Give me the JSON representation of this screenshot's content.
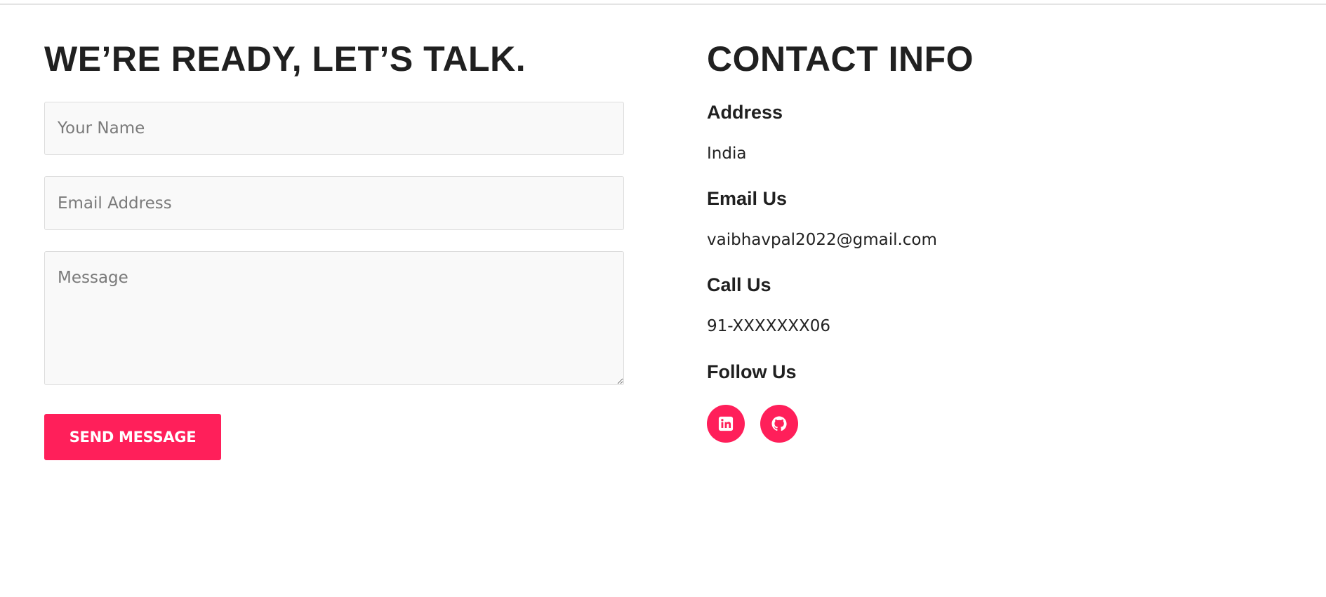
{
  "form": {
    "heading": "WE’RE READY, LET’S TALK.",
    "name_placeholder": "Your Name",
    "email_placeholder": "Email Address",
    "message_placeholder": "Message",
    "send_label": "SEND MESSAGE"
  },
  "contact": {
    "title": "CONTACT INFO",
    "address_label": "Address",
    "address_value": "India",
    "email_label": "Email Us",
    "email_value": "vaibhavpal2022@gmail.com",
    "call_label": "Call Us",
    "call_value": "91-XXXXXXX06",
    "follow_label": "Follow Us",
    "socials": [
      {
        "icon": "linkedin-icon"
      },
      {
        "icon": "github-icon"
      }
    ]
  },
  "colors": {
    "accent": "#ff1f5a",
    "text": "#202020",
    "field_bg": "#f9f9f9",
    "field_border": "#dcdcdc"
  }
}
